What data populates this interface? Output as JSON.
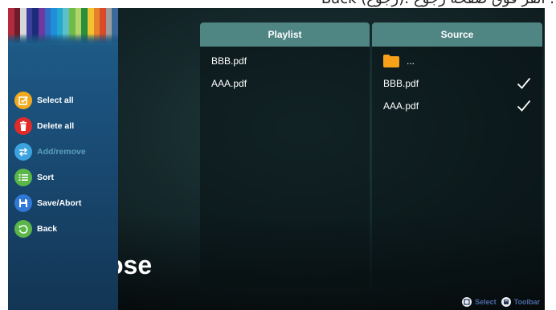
{
  "top_caption": "Back (رجوع): انقر فوق صفحة رجوع .",
  "background_text": "ose",
  "sidebar": {
    "pencil_colors": [
      "#b22a3c",
      "#6c1c2a",
      "#d8d8d8",
      "#3d3f9e",
      "#1d2c7a",
      "#6e3aa0",
      "#2f6ec4",
      "#1e8fd8",
      "#26a7d2",
      "#5bc0c8",
      "#6fbb4a",
      "#b2d36a",
      "#2a8e3a",
      "#f0c330",
      "#e8802a",
      "#d84a2a",
      "#9c9c9c",
      "#3a6a9c"
    ],
    "items": [
      {
        "label": "Select all",
        "icon": "select-all-icon",
        "color": "#f3a91e",
        "enabled": true
      },
      {
        "label": "Delete all",
        "icon": "trash-icon",
        "color": "#e12b2b",
        "enabled": true
      },
      {
        "label": "Add/remove",
        "icon": "swap-icon",
        "color": "#3aa3e0",
        "enabled": false
      },
      {
        "label": "Sort",
        "icon": "list-icon",
        "color": "#5bb64a",
        "enabled": true
      },
      {
        "label": "Save/Abort",
        "icon": "save-icon",
        "color": "#2f78d6",
        "enabled": true
      },
      {
        "label": "Back",
        "icon": "back-icon",
        "color": "#5bb64a",
        "enabled": true
      }
    ]
  },
  "playlist": {
    "title": "Playlist",
    "files": [
      "BBB.pdf",
      "AAA.pdf"
    ]
  },
  "source": {
    "title": "Source",
    "folder_label": "...",
    "files": [
      {
        "name": "BBB.pdf",
        "checked": true
      },
      {
        "name": "AAA.pdf",
        "checked": true
      }
    ]
  },
  "hints": {
    "select_label": "Select",
    "toolbar_label": "Toolbar"
  },
  "colors": {
    "header": "#4f8583",
    "folder": "#f7a11a",
    "hint_text": "#4e6aa6"
  }
}
